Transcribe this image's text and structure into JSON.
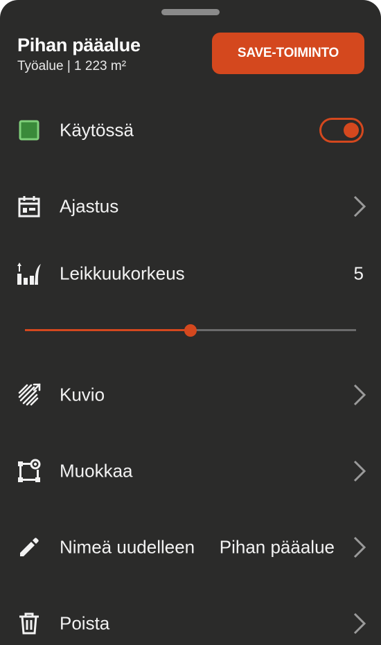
{
  "header": {
    "title": "Pihan pääalue",
    "subtitle": "Työalue | 1 223 m²",
    "save_label": "SAVE-TOIMINTO"
  },
  "colors": {
    "accent": "#d4481e",
    "checkbox": "#3a8a3a",
    "background": "#2b2b2a"
  },
  "items": {
    "enabled": {
      "label": "Käytössä",
      "icon": "checkbox-icon",
      "toggle_on": true
    },
    "schedule": {
      "label": "Ajastus",
      "icon": "calendar-icon"
    },
    "cut_height": {
      "label": "Leikkuukorkeus",
      "icon": "cut-height-icon",
      "value": "5",
      "slider_fraction": 0.5
    },
    "pattern": {
      "label": "Kuvio",
      "icon": "pattern-icon"
    },
    "edit": {
      "label": "Muokkaa",
      "icon": "edit-shape-icon"
    },
    "rename": {
      "label": "Nimeä uudelleen",
      "icon": "pencil-icon",
      "value": "Pihan pääalue"
    },
    "delete": {
      "label": "Poista",
      "icon": "trash-icon"
    }
  }
}
